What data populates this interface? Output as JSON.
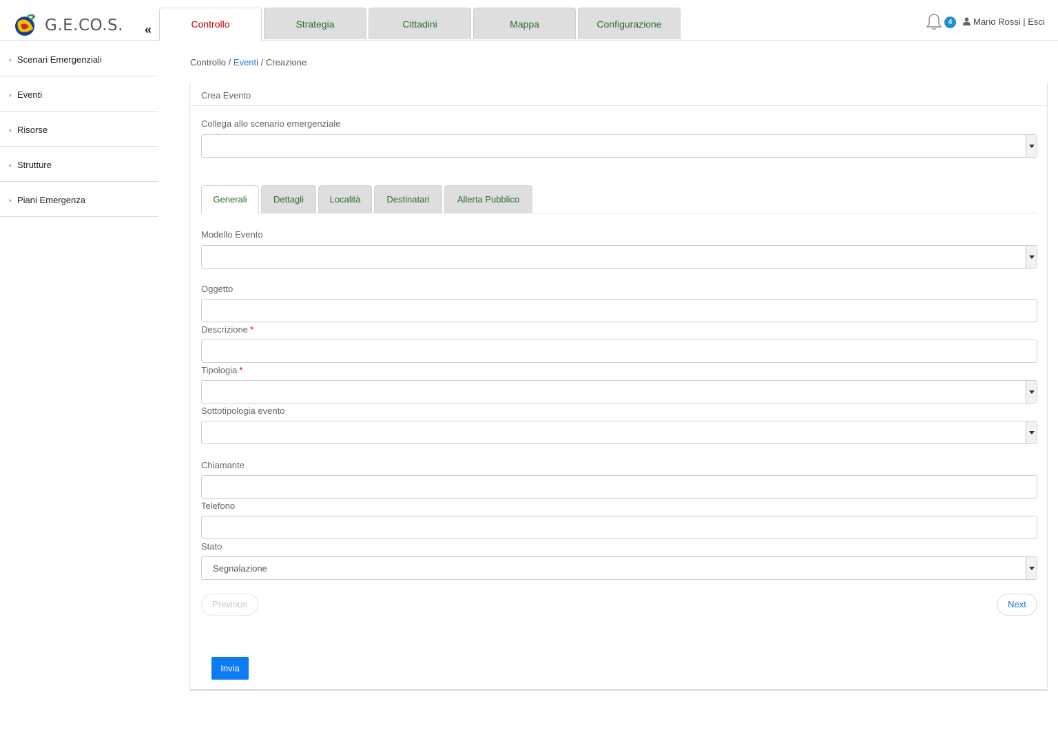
{
  "app": {
    "brand": "G.E.CO.S.",
    "collapse": "«"
  },
  "topnav": [
    "Controllo",
    "Strategia",
    "Cittadini",
    "Mappa",
    "Configurazione"
  ],
  "notifications": {
    "count": "4"
  },
  "user": {
    "text": "Mario Rossi | Esci"
  },
  "sidebar": [
    "Scenari Emergenziali",
    "Eventi",
    "Risorse",
    "Strutture",
    "Piani Emergenza"
  ],
  "breadcrumb": {
    "root": "Controllo",
    "sep1": "/",
    "section": "Eventi",
    "sep2": "/",
    "current": "Creazione"
  },
  "panel": {
    "title": "Crea Evento"
  },
  "form": {
    "scenario_label": "Collega allo scenario emergenziale",
    "scenario_value": "",
    "tabs": [
      "Generali",
      "Dettagli",
      "Località",
      "Destinatari",
      "Allerta Pubblico"
    ],
    "modello_label": "Modello Evento",
    "modello_value": "",
    "oggetto_label": "Oggetto",
    "oggetto_value": "",
    "descrizione_label": "Descrizione",
    "descrizione_value": "",
    "tipologia_label": "Tipologia",
    "tipologia_value": "",
    "sottotipologia_label": "Sottotipologia evento",
    "sottotipologia_value": "",
    "chiamante_label": "Chiamante",
    "chiamante_value": "",
    "telefono_label": "Telefono",
    "telefono_value": "",
    "stato_label": "Stato",
    "stato_value": "Segnalazione",
    "required_mark": "*",
    "previous": "Previous",
    "next": "Next",
    "submit": "Invia"
  },
  "colors": {
    "accent": "#0d7cf2",
    "active_tab": "#c00000",
    "tab_text": "#2e6b2e",
    "badge": "#1f8fd6"
  }
}
